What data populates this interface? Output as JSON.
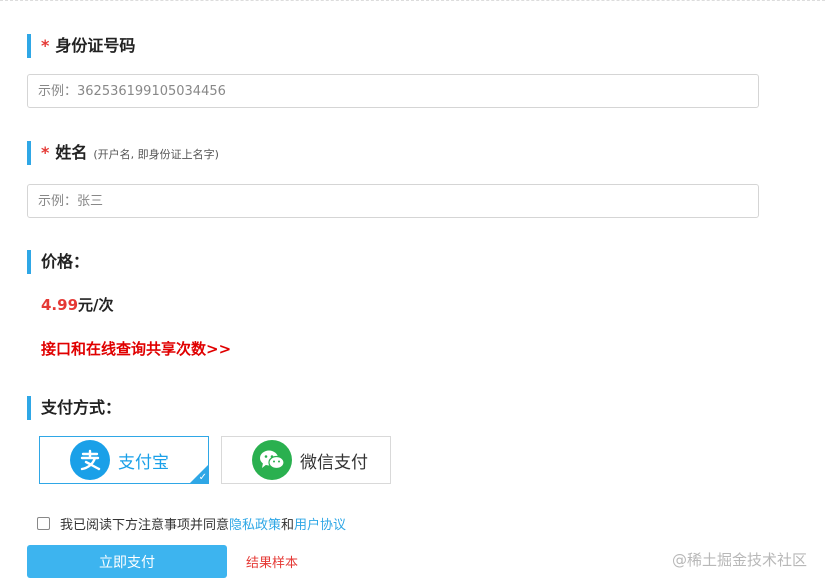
{
  "id_section": {
    "required_mark": "*",
    "title": "身份证号码",
    "placeholder": "示例：362536199105034456"
  },
  "name_section": {
    "required_mark": "*",
    "title": "姓名",
    "hint": "(开户名, 即身份证上名字)",
    "placeholder": "示例：张三"
  },
  "price_section": {
    "title": "价格：",
    "amount": "4.99",
    "unit": "元/次",
    "share_link": "接口和在线查询共享次数>>"
  },
  "payment_section": {
    "title": "支付方式：",
    "options": [
      {
        "label": "支付宝",
        "selected": true,
        "color": "#1aa0e8"
      },
      {
        "label": "微信支付",
        "selected": false,
        "color": "#2ab04f"
      }
    ]
  },
  "agreement": {
    "text_prefix": "我已阅读下方注意事项并同意",
    "privacy_link": "隐私政策",
    "conjunction": "和",
    "user_link": "用户协议",
    "checked": false
  },
  "actions": {
    "pay_button": "立即支付",
    "sample_link": "结果样本"
  },
  "watermark": "@稀土掘金技术社区",
  "colors": {
    "accent": "#2fa7e6",
    "required": "#e53935",
    "price": "#e53935",
    "share_link": "#e00000",
    "button": "#3db4ef"
  }
}
